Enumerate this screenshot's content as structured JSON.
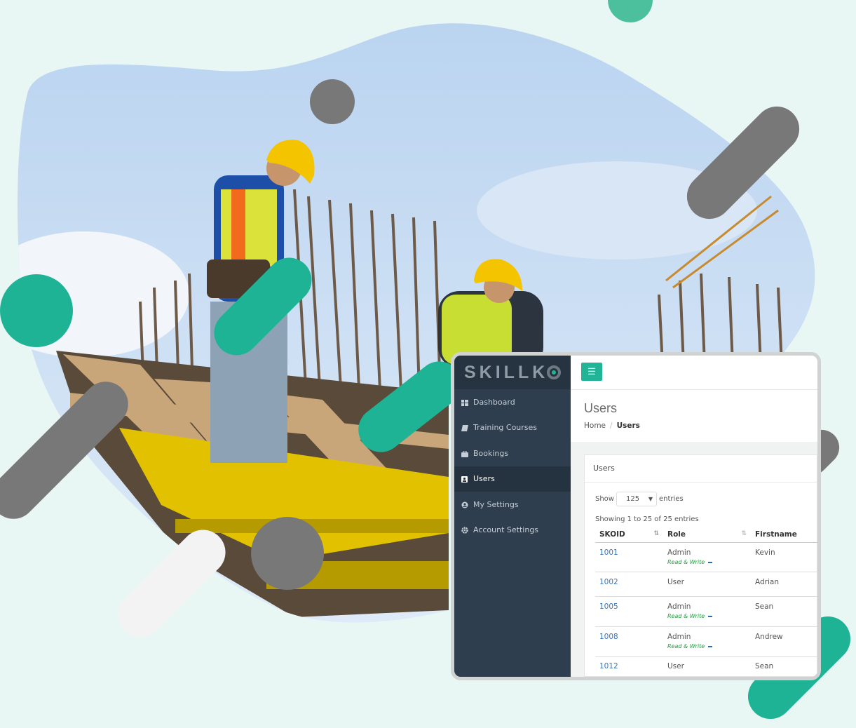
{
  "app": {
    "logo_text": "SKILLK",
    "menu_icon": "hamburger-icon",
    "accent": "#21b496",
    "sidebar_bg": "#2e3e4e"
  },
  "sidebar": {
    "items": [
      {
        "label": "Dashboard",
        "icon": "dashboard-icon"
      },
      {
        "label": "Training Courses",
        "icon": "book-icon"
      },
      {
        "label": "Bookings",
        "icon": "briefcase-icon"
      },
      {
        "label": "Users",
        "icon": "user-icon",
        "active": true
      },
      {
        "label": "My Settings",
        "icon": "user-circle-icon"
      },
      {
        "label": "Account Settings",
        "icon": "gear-icon"
      }
    ]
  },
  "page": {
    "title": "Users",
    "breadcrumb": {
      "home": "Home",
      "sep": "/",
      "current": "Users"
    }
  },
  "card": {
    "title": "Users",
    "show_label": "Show",
    "page_size": "125",
    "entries_label": "entries",
    "info": "Showing 1 to 25 of 25 entries"
  },
  "table": {
    "columns": [
      "SKOID",
      "Role",
      "Firstname"
    ],
    "rows": [
      {
        "id": "1001",
        "role": "Admin",
        "perm": "Read & Write",
        "first": "Kevin"
      },
      {
        "id": "1002",
        "role": "User",
        "perm": "",
        "first": "Adrian"
      },
      {
        "id": "1005",
        "role": "Admin",
        "perm": "Read & Write",
        "first": "Sean"
      },
      {
        "id": "1008",
        "role": "Admin",
        "perm": "Read & Write",
        "first": "Andrew"
      },
      {
        "id": "1012",
        "role": "User",
        "perm": "",
        "first": "Sean"
      }
    ]
  }
}
